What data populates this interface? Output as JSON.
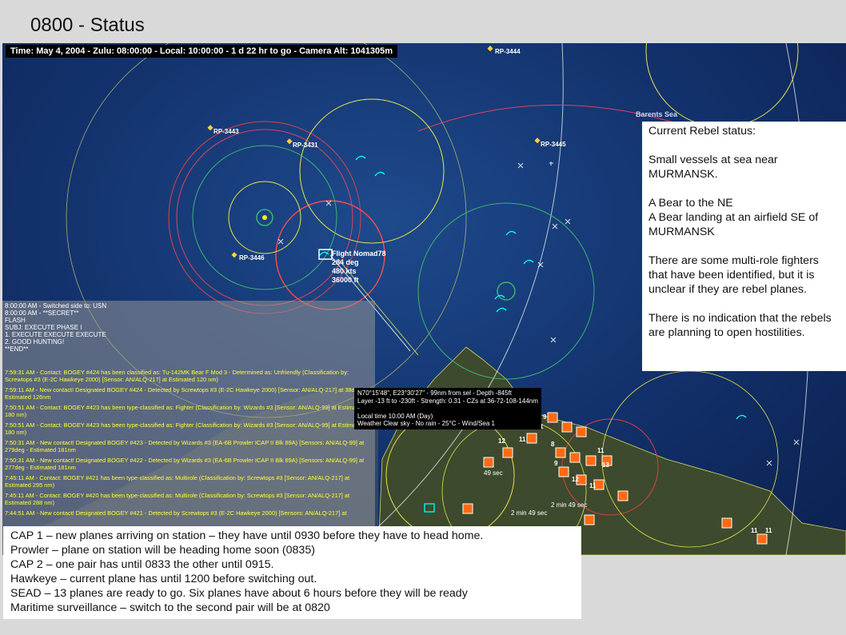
{
  "slide": {
    "title": "0800 - Status"
  },
  "map": {
    "time_bar": "Time: May 4, 2004 - Zulu: 08:00:00 - Local: 10:00:00 - 1 d 22 hr to go -  Camera Alt: 1041305m",
    "sea_label": "Barents Sea",
    "reference_points": [
      "RP-3444",
      "RP-3443",
      "RP-3431",
      "RP-3445",
      "RP-3446"
    ],
    "flight": {
      "name": "Flight Nomad78",
      "heading": "284 deg",
      "speed": "480 kts",
      "altitude": "36000 ft"
    },
    "tooltip": [
      "N70°15'48\", E23°30'27\" - 99nm from sel - Depth -845ft",
      "Layer -13 ft to -230ft - Strength: 0.31 - CZs at 36-72-108-144nm -",
      "Local time 10:00 AM (Day)",
      "Weather Clear sky - No rain - 25°C - Wind/Sea 1"
    ],
    "map_labels": [
      "49 sec",
      "2 min 49 sec",
      "2 min 49 sec"
    ],
    "unit_counts": [
      "9",
      "11",
      "8",
      "9",
      "11",
      "12",
      "11",
      "13",
      "12",
      "11",
      "11",
      "11"
    ],
    "colors": {
      "ocean": "#12306a",
      "friendly": "#00ffff",
      "hostile": "#ff6a13",
      "ring_yellow": "#e6e64a",
      "ring_red": "#e04040",
      "ring_green": "#3cb371"
    }
  },
  "message_log": {
    "flash": [
      "8:00:00 AM - Switched side to: USN",
      "8:00:00 AM - **SECRET**",
      "FLASH",
      "SUBJ: EXECUTE PHASE I",
      "1. EXECUTE EXECUTE EXECUTE",
      "2. GOOD HUNTING!",
      "**END**"
    ],
    "items": [
      "7:59:31 AM - Contact: BOGEY #424 has been classified as: Tu-142MK Bear F Mod 3 - Determined as: Unfriendly (Classification by: Screwtops #3 (E-2C Hawkeye 2000) [Sensor: AN/ALQ-217] at Estimated 120 nm)",
      "7:59:11 AM - New contact! Designated BOGEY #424 - Detected by Screwtops #3 (E-2C Hawkeye 2000) [Sensor: AN/ALQ-217] at 38deg - Estimated 126nm",
      "7:50:51 AM - Contact: BOGEY #423 has been type-classified as: Fighter (Classification by: Wizards #3 [Sensor: AN/ALQ-99] at Estimated 180 nm)",
      "7:50:51 AM - Contact: BOGEY #423 has been type-classified as: Fighter (Classification by: Wizards #3 [Sensor: AN/ALQ-99] at Estimated 180 nm)",
      "7:50:31 AM - New contact! Designated BOGEY #423 - Detected by Wizards #3 (EA-6B Prowler ICAP II Blk 89A) [Sensors: AN/ALQ-99] at 279deg - Estimated 181nm",
      "7:50:31 AM - New contact! Designated BOGEY #422 - Detected by Wizards #3 (EA-6B Prowler ICAP II Blk 89A) [Sensors: AN/ALQ-99] at 277deg - Estimated 181nm",
      "7:45:11 AM - Contact: BOGEY #421 has been type-classified as: Multirole (Classification by: Screwtops #3 [Sensor: AN/ALQ-217] at Estimated 295 nm)",
      "7:45:11 AM - Contact: BOGEY #420 has been type-classified as: Multirole (Classification by: Screwtops #3 [Sensor: AN/ALQ-217] at Estimated 288 nm)",
      "7:44:51 AM - New contact! Designated BOGEY #421 - Detected by Screwtops #3 (E-2C Hawkeye 2000) [Sensors: AN/ALQ-217] at"
    ]
  },
  "side_panel": {
    "heading": "Current Rebel status:",
    "paragraphs": [
      "Small vessels at sea near MURMANSK.",
      "A Bear to the NE\nA Bear landing at an airfield SE of MURMANSK",
      "There are some multi-role fighters that have been identified, but it is unclear if they are rebel planes.",
      "There is no indication that the rebels are planning to open hostilities."
    ]
  },
  "bottom_panel": {
    "lines": [
      "CAP 1 – new planes arriving on station – they have until 0930 before they have to head home.",
      "Prowler – plane on station will be heading home soon (0835)",
      "CAP 2 – one pair has until 0833 the other until 0915.",
      "Hawkeye – current plane has until 1200 before switching out.",
      "SEAD – 13 planes are ready to go.  Six planes have about 6 hours before they will be ready",
      "Maritime surveillance – switch to the second pair will be at 0820"
    ]
  }
}
